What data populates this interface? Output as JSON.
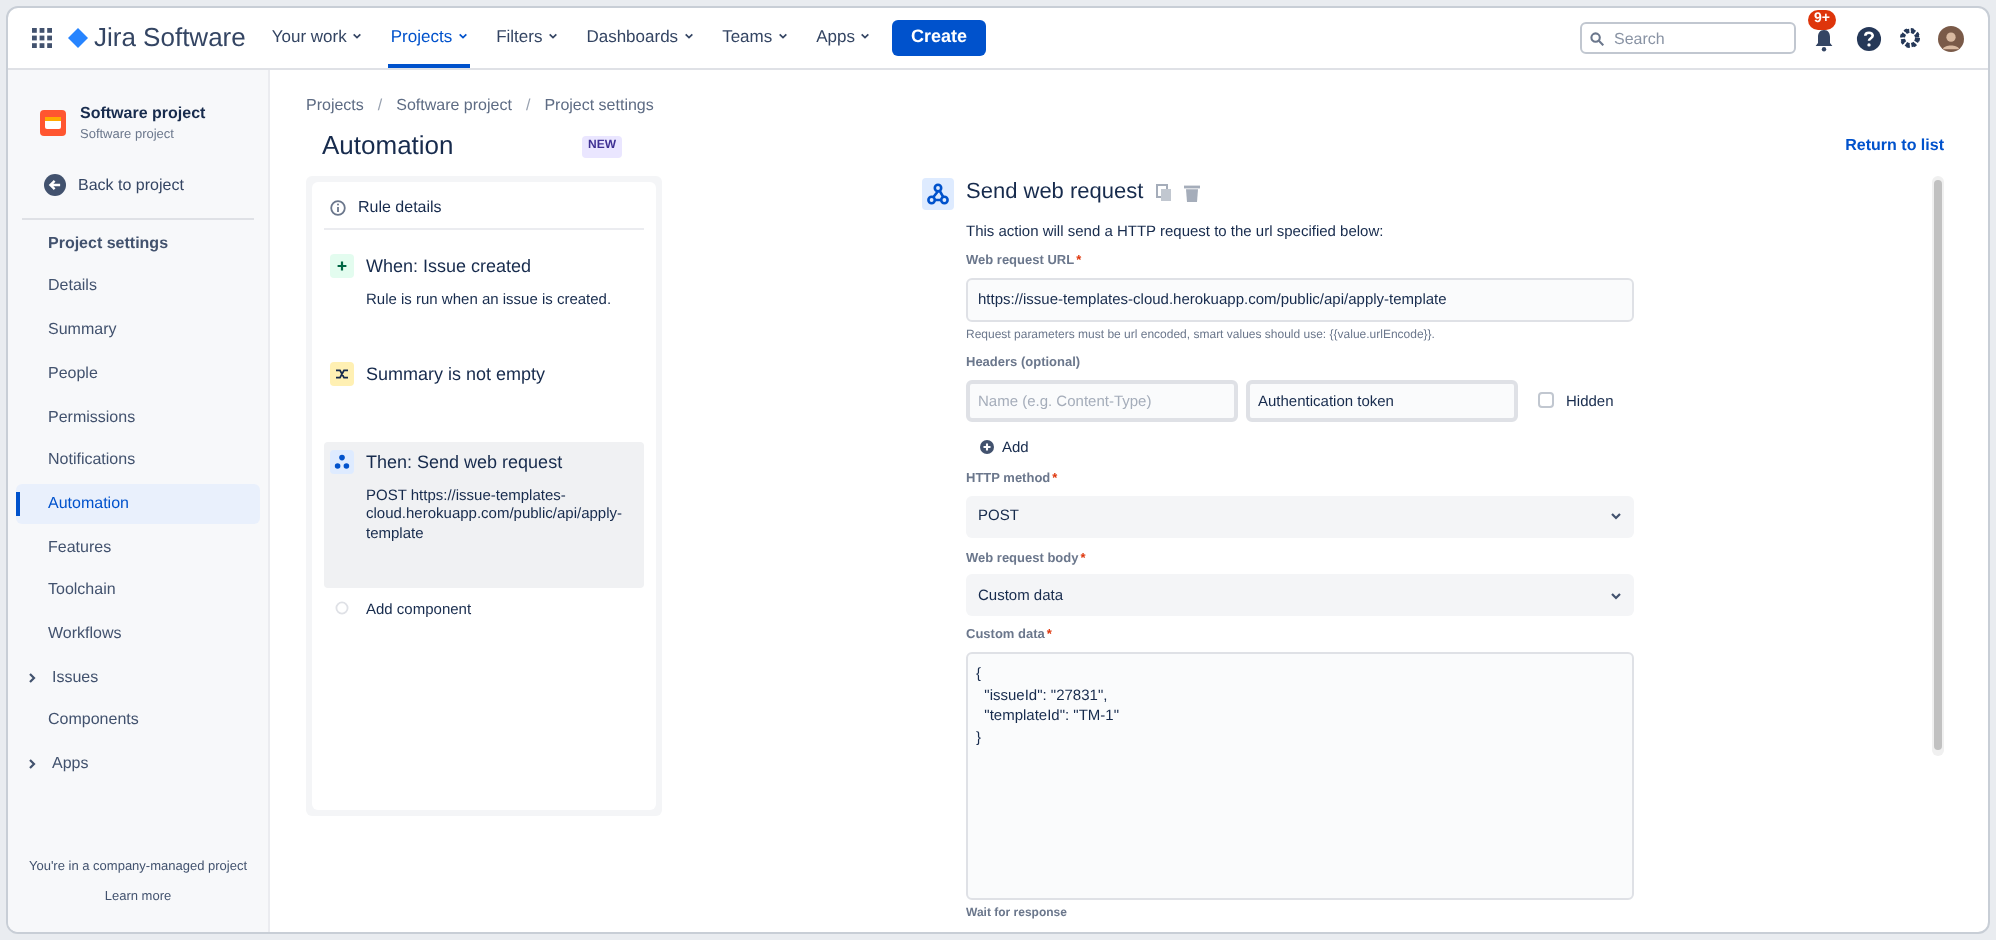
{
  "top_nav": {
    "product": "Jira Software",
    "items": [
      {
        "label": "Your work",
        "selected": false
      },
      {
        "label": "Projects",
        "selected": true
      },
      {
        "label": "Filters",
        "selected": false
      },
      {
        "label": "Dashboards",
        "selected": false
      },
      {
        "label": "Teams",
        "selected": false
      },
      {
        "label": "Apps",
        "selected": false
      }
    ],
    "create_button": "Create",
    "search": {
      "placeholder": "Search"
    },
    "notification_badge": "9+"
  },
  "sidebar": {
    "project_name": "Software project",
    "project_type": "Software project",
    "back_link": "Back to project",
    "section_title": "Project settings",
    "items": [
      {
        "label": "Details",
        "selected": false,
        "expandable": false
      },
      {
        "label": "Summary",
        "selected": false,
        "expandable": false
      },
      {
        "label": "People",
        "selected": false,
        "expandable": false
      },
      {
        "label": "Permissions",
        "selected": false,
        "expandable": false
      },
      {
        "label": "Notifications",
        "selected": false,
        "expandable": false
      },
      {
        "label": "Automation",
        "selected": true,
        "expandable": false
      },
      {
        "label": "Features",
        "selected": false,
        "expandable": false
      },
      {
        "label": "Toolchain",
        "selected": false,
        "expandable": false
      },
      {
        "label": "Workflows",
        "selected": false,
        "expandable": false
      },
      {
        "label": "Issues",
        "selected": false,
        "expandable": true
      },
      {
        "label": "Components",
        "selected": false,
        "expandable": false
      },
      {
        "label": "Apps",
        "selected": false,
        "expandable": true
      }
    ],
    "footer_text": "You're in a company-managed project",
    "footer_link": "Learn more"
  },
  "breadcrumbs": [
    {
      "kind": "link",
      "text": "Projects"
    },
    {
      "kind": "separator",
      "text": "/"
    },
    {
      "kind": "link",
      "text": "Software project"
    },
    {
      "kind": "separator",
      "text": "/"
    },
    {
      "kind": "link",
      "text": "Project settings"
    }
  ],
  "page_title": "Automation",
  "new_badge": "NEW",
  "return_link": "Return to list",
  "rule": {
    "details_label": "Rule details",
    "steps": [
      {
        "kind": "trigger",
        "title": "When: Issue created",
        "description": "Rule is run when an issue is created.",
        "selected": false
      },
      {
        "kind": "condition",
        "title": "Summary is not empty",
        "selected": false
      },
      {
        "kind": "action",
        "title": "Then: Send web request",
        "description": "POST https://issue-templates-cloud.herokuapp.com/public/api/apply-template",
        "selected": true
      },
      {
        "kind": "add",
        "title": "Add component",
        "selected": false
      }
    ]
  },
  "editor": {
    "title": "Send web request",
    "intro": "This action will send a HTTP request to the url specified below:",
    "url_label": "Web request URL",
    "url_required": "*",
    "method_required": "*",
    "body_required": "*",
    "custom_required": "*",
    "url_value": "https://issue-templates-cloud.herokuapp.com/public/api/apply-template",
    "url_help": "Request parameters must be url encoded, smart values should use: {{value.urlEncode}}.",
    "headers_label": "Headers (optional)",
    "header_name_placeholder": "Name (e.g. Content-Type)",
    "header_value": "Authentication token",
    "hidden_label": "Hidden",
    "hidden_checked": false,
    "add_label": "Add",
    "method_label": "HTTP method",
    "method_value": "POST",
    "body_label": "Web request body",
    "body_value": "Custom data",
    "custom_label": "Custom data",
    "custom_value": "{\n  \"issueId\": \"27831\",\n  \"templateId\": \"TM-1\"\n}",
    "next_label": "Wait for response"
  }
}
